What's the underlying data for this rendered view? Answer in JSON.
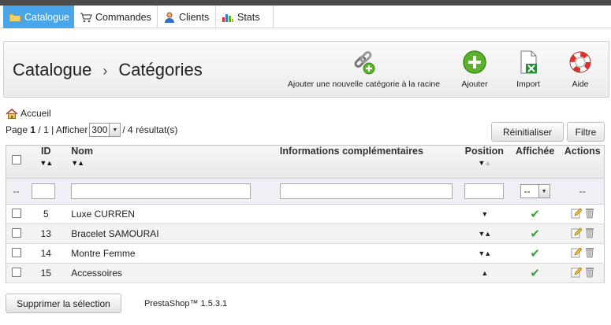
{
  "tabs": [
    {
      "label": "Catalogue",
      "icon": "folder-icon"
    },
    {
      "label": "Commandes",
      "icon": "cart-icon"
    },
    {
      "label": "Clients",
      "icon": "user-icon"
    },
    {
      "label": "Stats",
      "icon": "chart-icon"
    }
  ],
  "toolbar": {
    "breadcrumb_root": "Catalogue",
    "breadcrumb_sep": "›",
    "breadcrumb_current": "Catégories",
    "add_root_label": "Ajouter une nouvelle catégorie à la racine",
    "add_label": "Ajouter",
    "import_label": "Import",
    "help_label": "Aide"
  },
  "home_crumb": "Accueil",
  "pager": {
    "page_prefix": "Page",
    "page": "1",
    "page_of": "/ 1",
    "show_label": "| Afficher",
    "per_page": "300",
    "results": "/ 4 résultat(s)"
  },
  "buttons": {
    "reset": "Réinitialiser",
    "filter": "Filtre",
    "delete_selection": "Supprimer la sélection"
  },
  "table": {
    "headers": {
      "id": "ID",
      "name": "Nom",
      "info": "Informations complémentaires",
      "position": "Position",
      "displayed": "Affichée",
      "actions": "Actions"
    },
    "filter": {
      "checkbox_placeholder": "--",
      "displayed_select": "--",
      "actions_placeholder": "--"
    },
    "rows": [
      {
        "id": "5",
        "name": "Luxe CURREN",
        "info": "",
        "position": "down",
        "displayed": true
      },
      {
        "id": "13",
        "name": "Bracelet SAMOURAI",
        "info": "",
        "position": "both",
        "displayed": true
      },
      {
        "id": "14",
        "name": "Montre Femme",
        "info": "",
        "position": "both",
        "displayed": true
      },
      {
        "id": "15",
        "name": "Accessoires",
        "info": "",
        "position": "up",
        "displayed": true
      }
    ]
  },
  "footer": {
    "version": "PrestaShop™ 1.5.3.1"
  },
  "colors": {
    "active_tab": "#49a6e8",
    "check_green": "#3ca33c",
    "add_green": "#5db22d",
    "help_red": "#d9312b"
  }
}
